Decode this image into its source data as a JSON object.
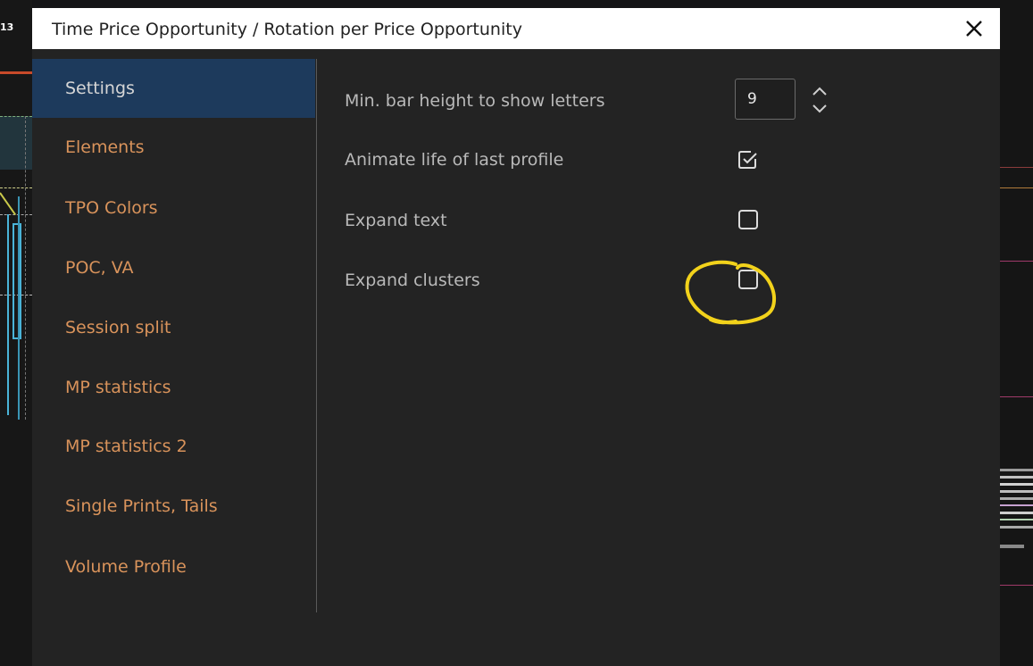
{
  "dialog": {
    "title": "Time Price Opportunity / Rotation per Price Opportunity",
    "close_icon": "close-icon"
  },
  "sidebar": {
    "items": [
      {
        "label": "Settings",
        "active": true
      },
      {
        "label": "Elements",
        "active": false
      },
      {
        "label": "TPO Colors",
        "active": false
      },
      {
        "label": "POC, VA",
        "active": false
      },
      {
        "label": "Session split",
        "active": false
      },
      {
        "label": "MP statistics",
        "active": false
      },
      {
        "label": "MP statistics 2",
        "active": false
      },
      {
        "label": "Single Prints, Tails",
        "active": false
      },
      {
        "label": "Volume Profile",
        "active": false
      }
    ]
  },
  "settings": {
    "min_bar_height": {
      "label": "Min. bar height to show letters",
      "value": "9"
    },
    "animate_life": {
      "label": "Animate life of last profile",
      "checked": true
    },
    "expand_text": {
      "label": "Expand text",
      "checked": false
    },
    "expand_clusters": {
      "label": "Expand clusters",
      "checked": false
    }
  },
  "background": {
    "left_tick_text": "13"
  },
  "colors": {
    "active_nav_bg": "#1d3a5c",
    "nav_text": "#d9935b",
    "annotation": "#f2d21b"
  }
}
